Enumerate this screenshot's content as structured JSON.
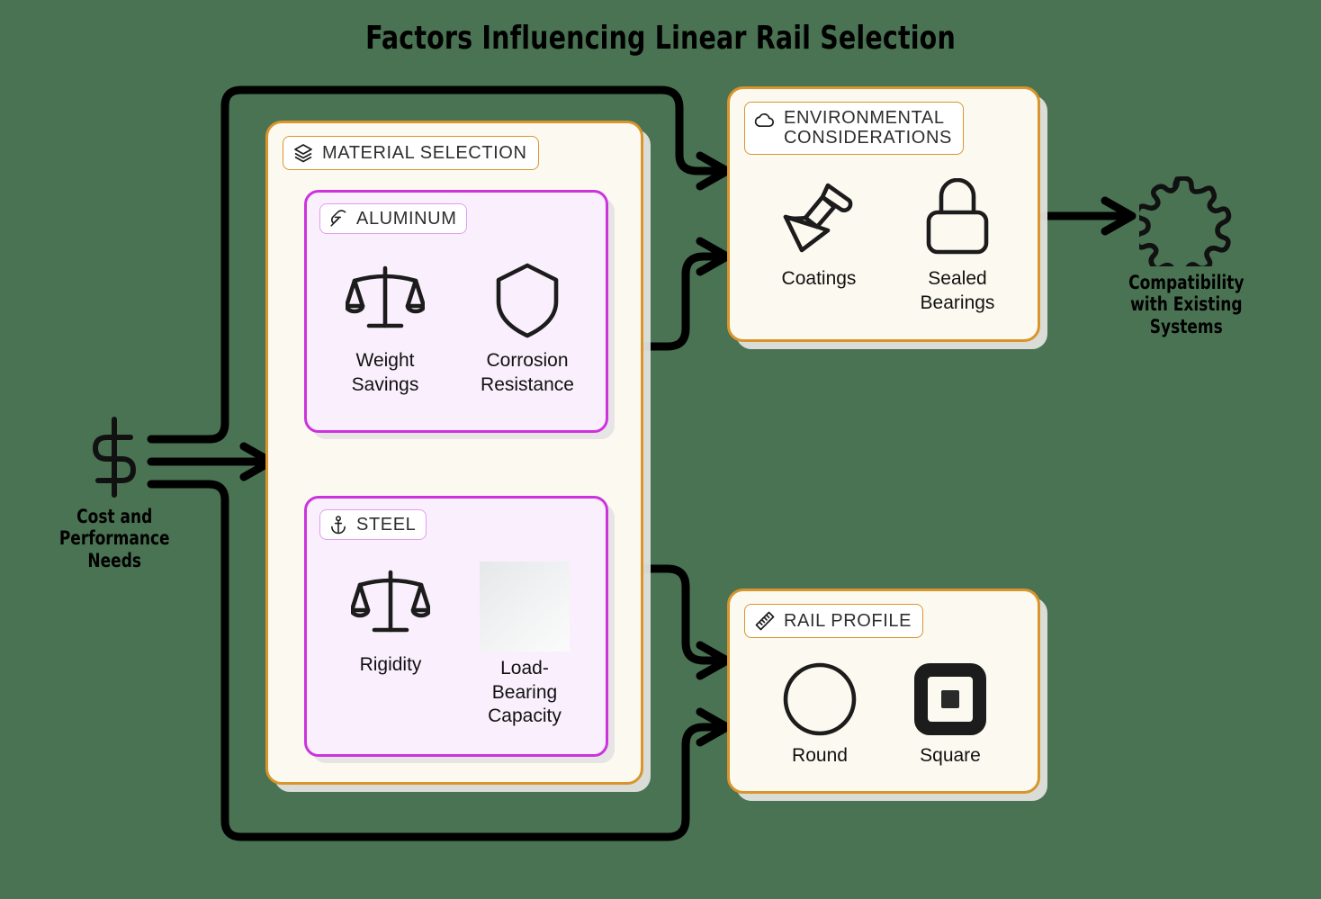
{
  "title": "Factors Influencing Linear Rail Selection",
  "background_color": "#4a7353",
  "palette": {
    "card_fill": "#fcfaf0",
    "card_border": "#d9952b",
    "subcard_fill": "#faf0fd",
    "subcard_border": "#cc33dd",
    "ink": "#111111",
    "arrow": "#000000"
  },
  "nodes": {
    "cost": {
      "label": "Cost and\nPerformance\nNeeds",
      "icon": "dollar-sign-icon"
    },
    "compatibility": {
      "label": "Compatibility\nwith Existing\nSystems",
      "icon": "puzzle-piece-icon"
    }
  },
  "cards": {
    "material_selection": {
      "pill_label": "MATERIAL SELECTION",
      "pill_icon": "layers-icon",
      "subcards": {
        "aluminum": {
          "pill_label": "ALUMINUM",
          "pill_icon": "feather-icon",
          "items": [
            {
              "label": "Weight\nSavings",
              "icon": "balance-scale-icon"
            },
            {
              "label": "Corrosion\nResistance",
              "icon": "shield-icon"
            }
          ]
        },
        "steel": {
          "pill_label": "STEEL",
          "pill_icon": "anchor-icon",
          "items": [
            {
              "label": "Rigidity",
              "icon": "balance-scale-icon"
            },
            {
              "label": "Load-\nBearing\nCapacity",
              "icon": "blank-placeholder-icon"
            }
          ]
        }
      }
    },
    "environmental": {
      "pill_label": "ENVIRONMENTAL\nCONSIDERATIONS",
      "pill_icon": "cloud-icon",
      "items": [
        {
          "label": "Coatings",
          "icon": "paintbrush-icon"
        },
        {
          "label": "Sealed\nBearings",
          "icon": "padlock-icon"
        }
      ]
    },
    "rail_profile": {
      "pill_label": "RAIL PROFILE",
      "pill_icon": "ruler-icon",
      "items": [
        {
          "label": "Round",
          "icon": "circle-outline-icon"
        },
        {
          "label": "Square",
          "icon": "square-profile-icon"
        }
      ]
    }
  },
  "connections": [
    {
      "from": "cost",
      "to": "environmental"
    },
    {
      "from": "cost",
      "to": "material_selection"
    },
    {
      "from": "cost",
      "to": "rail_profile"
    },
    {
      "from": "material_selection",
      "to": "environmental"
    },
    {
      "from": "material_selection",
      "to": "rail_profile"
    },
    {
      "from": "environmental",
      "to": "compatibility"
    }
  ]
}
